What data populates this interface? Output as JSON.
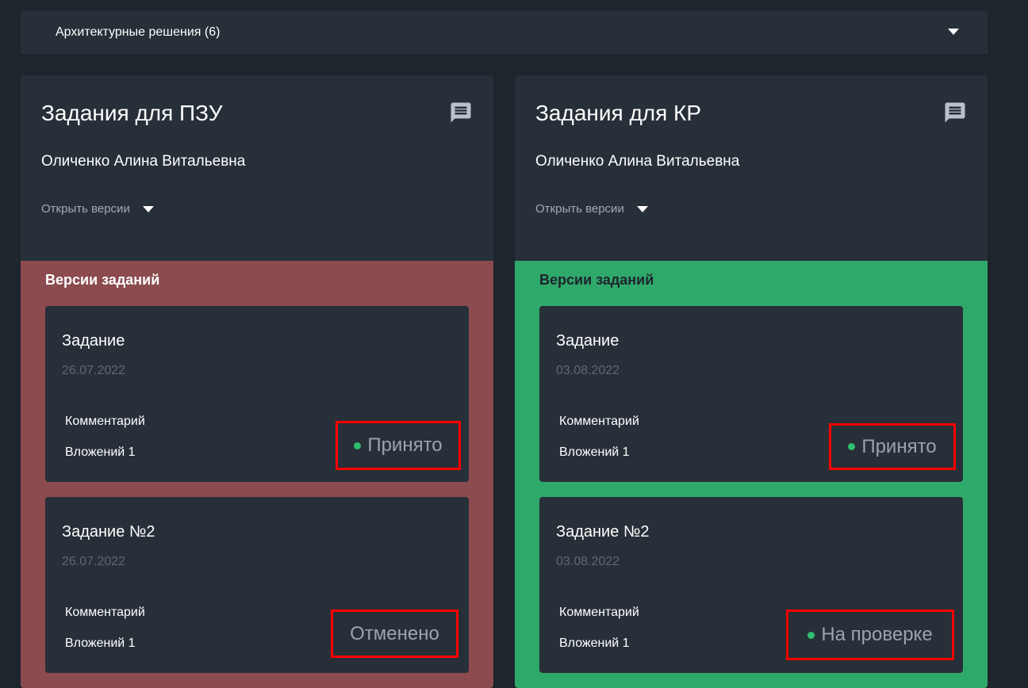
{
  "accordion": {
    "title": "Архитектурные решения (6)"
  },
  "panels": [
    {
      "title": "Задания для ПЗУ",
      "author": "Оличенко Алина Витальевна",
      "versions_toggle": "Открыть версии",
      "versions_title": "Версии заданий",
      "status_color": "#8c4b4f",
      "tasks": [
        {
          "title": "Задание",
          "date": "26.07.2022",
          "comment": "Комментарий",
          "attachments": "Вложений 1",
          "status": "Принято",
          "dot": true
        },
        {
          "title": "Задание №2",
          "date": "26.07.2022",
          "comment": "Комментарий",
          "attachments": "Вложений 1",
          "status": "Отменено",
          "dot": false
        }
      ]
    },
    {
      "title": "Задания для КР",
      "author": "Оличенко Алина Витальевна",
      "versions_toggle": "Открыть версии",
      "versions_title": "Версии заданий",
      "status_color": "#2fa96a",
      "tasks": [
        {
          "title": "Задание",
          "date": "03.08.2022",
          "comment": "Комментарий",
          "attachments": "Вложений 1",
          "status": "Принято",
          "dot": true
        },
        {
          "title": "Задание №2",
          "date": "03.08.2022",
          "comment": "Комментарий",
          "attachments": "Вложений 1",
          "status": "На проверке",
          "dot": true
        }
      ]
    }
  ],
  "colors": {
    "background": "#1d252d",
    "card": "#272f38",
    "highlight_border": "#ff0000",
    "status_dot": "#2fbf70"
  },
  "icons": {
    "comment": "comment-icon",
    "caret": "chevron-down-icon"
  }
}
